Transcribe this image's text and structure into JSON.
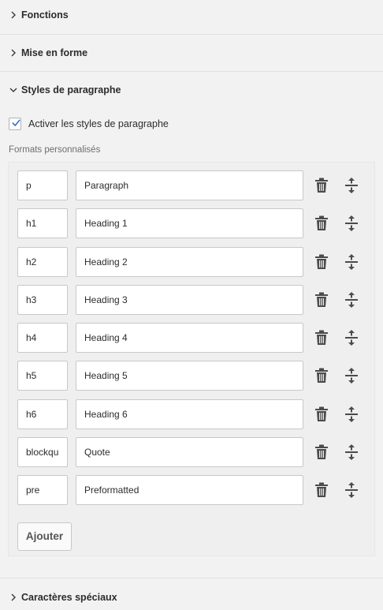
{
  "sections": {
    "functions": "Fonctions",
    "formatting": "Mise en forme",
    "paragraph_styles": "Styles de paragraphe",
    "special_chars": "Caractères spéciaux"
  },
  "paragraph": {
    "enable_label": "Activer les styles de paragraphe",
    "enabled": true,
    "custom_formats_label": "Formats personnalisés",
    "formats": [
      {
        "tag": "p",
        "name": "Paragraph"
      },
      {
        "tag": "h1",
        "name": "Heading 1"
      },
      {
        "tag": "h2",
        "name": "Heading 2"
      },
      {
        "tag": "h3",
        "name": "Heading 3"
      },
      {
        "tag": "h4",
        "name": "Heading 4"
      },
      {
        "tag": "h5",
        "name": "Heading 5"
      },
      {
        "tag": "h6",
        "name": "Heading 6"
      },
      {
        "tag": "blockqu",
        "name": "Quote"
      },
      {
        "tag": "pre",
        "name": "Preformatted"
      }
    ],
    "add_label": "Ajouter"
  },
  "colors": {
    "checkbox_accent": "#2b6fd6",
    "icon": "#4b4b4b"
  }
}
